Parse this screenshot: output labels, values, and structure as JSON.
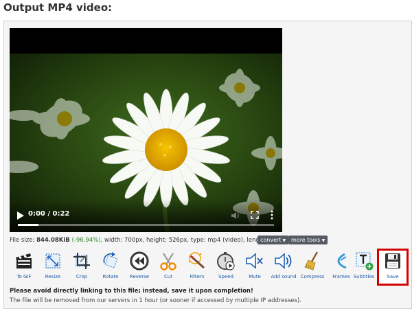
{
  "page": {
    "title": "Output MP4 video:"
  },
  "video": {
    "time_display": "0:00 / 0:22",
    "progress": 0.08
  },
  "file_info": {
    "label_size": "File size:",
    "size": "844.08KiB",
    "percent": "(-96.94%)",
    "details": ", width: 700px, height: 526px, type: mp4 (video), length: 00:00:22.56"
  },
  "menus": {
    "convert": "convert",
    "more_tools": "more tools"
  },
  "toolbar": [
    {
      "id": "to-gif",
      "label": "To GIF",
      "icon": "clapperboard-icon"
    },
    {
      "id": "resize",
      "label": "Resize",
      "icon": "resize-icon"
    },
    {
      "id": "crop",
      "label": "Crop",
      "icon": "crop-icon"
    },
    {
      "id": "rotate",
      "label": "Rotate",
      "icon": "rotate-icon"
    },
    {
      "id": "reverse",
      "label": "Reverse",
      "icon": "rewind-icon"
    },
    {
      "id": "cut",
      "label": "Cut",
      "icon": "scissors-icon"
    },
    {
      "id": "filters",
      "label": "Filters",
      "icon": "magic-wand-icon"
    },
    {
      "id": "speed",
      "label": "Speed",
      "icon": "stopwatch-icon"
    },
    {
      "id": "mute",
      "label": "Mute",
      "icon": "speaker-mute-icon"
    },
    {
      "id": "add-sound",
      "label": "Add sound",
      "icon": "speaker-sound-icon"
    },
    {
      "id": "compress",
      "label": "Compress",
      "icon": "broom-icon"
    },
    {
      "id": "frames",
      "label": "Frames",
      "icon": "frames-icon"
    },
    {
      "id": "subtitles",
      "label": "Subtitles",
      "icon": "subtitles-icon"
    },
    {
      "id": "save",
      "label": "Save",
      "icon": "floppy-disk-icon"
    }
  ],
  "notices": {
    "warning": "Please avoid directly linking to this file; instead, save it upon completion!",
    "info": "The file will be removed from our servers in 1 hour (or sooner if accessed by multiple IP addresses)."
  },
  "colors": {
    "link_blue": "#1a5aa6",
    "save_highlight": "#d40000",
    "percent_green": "#2a8a2a",
    "pill_bg": "#555a63"
  }
}
